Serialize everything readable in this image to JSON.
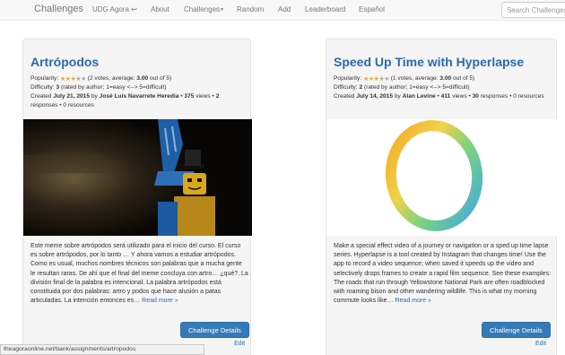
{
  "navbar": {
    "brand": "Challenges",
    "items": [
      {
        "label": "UDG Agora ↩"
      },
      {
        "label": "About"
      },
      {
        "label": "Challenges"
      },
      {
        "label": "Random"
      },
      {
        "label": "Add"
      },
      {
        "label": "Leaderboard"
      },
      {
        "label": "Español"
      }
    ],
    "search_placeholder": "Search Challenges"
  },
  "cards": [
    {
      "title": "Artrópodos",
      "popularity_label": "Popularity:",
      "rating_stars": 3,
      "votes_text": "(2 votes, average:",
      "average": "3.00",
      "out_of": "out of 5)",
      "difficulty_label": "Difficulty:",
      "difficulty_value": "3",
      "difficulty_note": "(rated by author; 1=easy <--> 5=difficult)",
      "created_label": "Created",
      "created_date": "July 21, 2015",
      "by_label": "by",
      "author": "José Luis Navarrete Heredia",
      "views": "375",
      "views_label": "views •",
      "responses": "2",
      "responses_label": "responses • 0 resources",
      "description": "Este meme sobre artrópodos será utilizado para el inicio del curso. El curso es sobre artrópodos, por lo tanto … Y ahora vamos a estudiar artrópodos. Como es usual, muchos nombres técnicos son palabras que a mucha gente le resultan raras. De ahí que el final del meme concluya con artro… ¿qué?. La división final de la palabra es intencional. La palabra artrópodos está constituida por dos palabras: artro y podos que hace alusión a patas articuladas. La intención entonces es…",
      "read_more": "Read more »",
      "button": "Challenge Details",
      "edit": "Edit"
    },
    {
      "title": "Speed Up Time with Hyperlapse",
      "popularity_label": "Popularity:",
      "rating_stars": 3,
      "votes_text": "(1 votes, average:",
      "average": "3.00",
      "out_of": "out of 5)",
      "difficulty_label": "Difficulty:",
      "difficulty_value": "2",
      "difficulty_note": "(rated by author; 1=easy <--> 5=difficult)",
      "created_label": "Created",
      "created_date": "July 14, 2015",
      "by_label": "by",
      "author": "Alan Levine",
      "views": "411",
      "views_label": "views •",
      "responses": "30",
      "responses_label": "responses • 0 resources",
      "description": "Make a special effect video of a journey or navigation or a sped up time lapse series. Hyperlapse is a tool created by Instagram that changes time! Use the app to record a video sequence; when saved it speeds up the video and selectively drops frames to create a rapid film sequence. See these examples: The roads that run through Yellowstone National Park are often roadblocked with roaming bison and other wandering wildlife. This is what my morning commute looks like…",
      "read_more": "Read more »",
      "button": "Challenge Details",
      "edit": "Edit"
    }
  ],
  "status_url": "theagoraonline.net/bank/assignments/artropodos",
  "colors": {
    "link": "#2a6ab0",
    "button": "#337ab7",
    "star": "#f0a830",
    "navbar_bg": "#f8f8f8",
    "card_bg": "#f5f5f5"
  }
}
